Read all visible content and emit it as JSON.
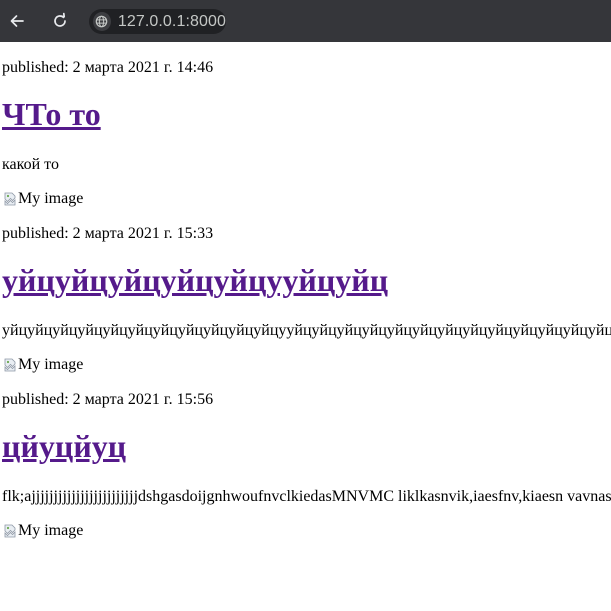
{
  "browser": {
    "url": "127.0.0.1:8000",
    "back_icon": "arrow-left-icon",
    "reload_icon": "reload-icon",
    "site_info_icon": "globe-icon"
  },
  "posts": [
    {
      "published": "published: 2 марта 2021 г. 14:46",
      "title": "ЧТо то",
      "description": "какой то",
      "image_alt": "My image"
    },
    {
      "published": "published: 2 марта 2021 г. 15:33",
      "title": "уйцуйцуйцуйцуйцууйцуйц",
      "description": "уйцуйцуйцуйцуйцуйцуйцуйцуйцуйцуйцууйцуйцуйцуйцуйцуйцуйцуйцуйцуйцуйцуйцуйцуйцуйцуйцуйцуйцуйцуйц",
      "image_alt": "My image"
    },
    {
      "published": "published: 2 марта 2021 г. 15:56",
      "title": "цйуцйуц",
      "description": "flk;ajjjjjjjjjjjjjjjjjjjjjjjjdshgasdoijgnhwoufnvclkiedasMNVMC liklkasnvik,iaesfnv,kiaesn vavnaslkvn",
      "image_alt": "My image"
    }
  ]
}
